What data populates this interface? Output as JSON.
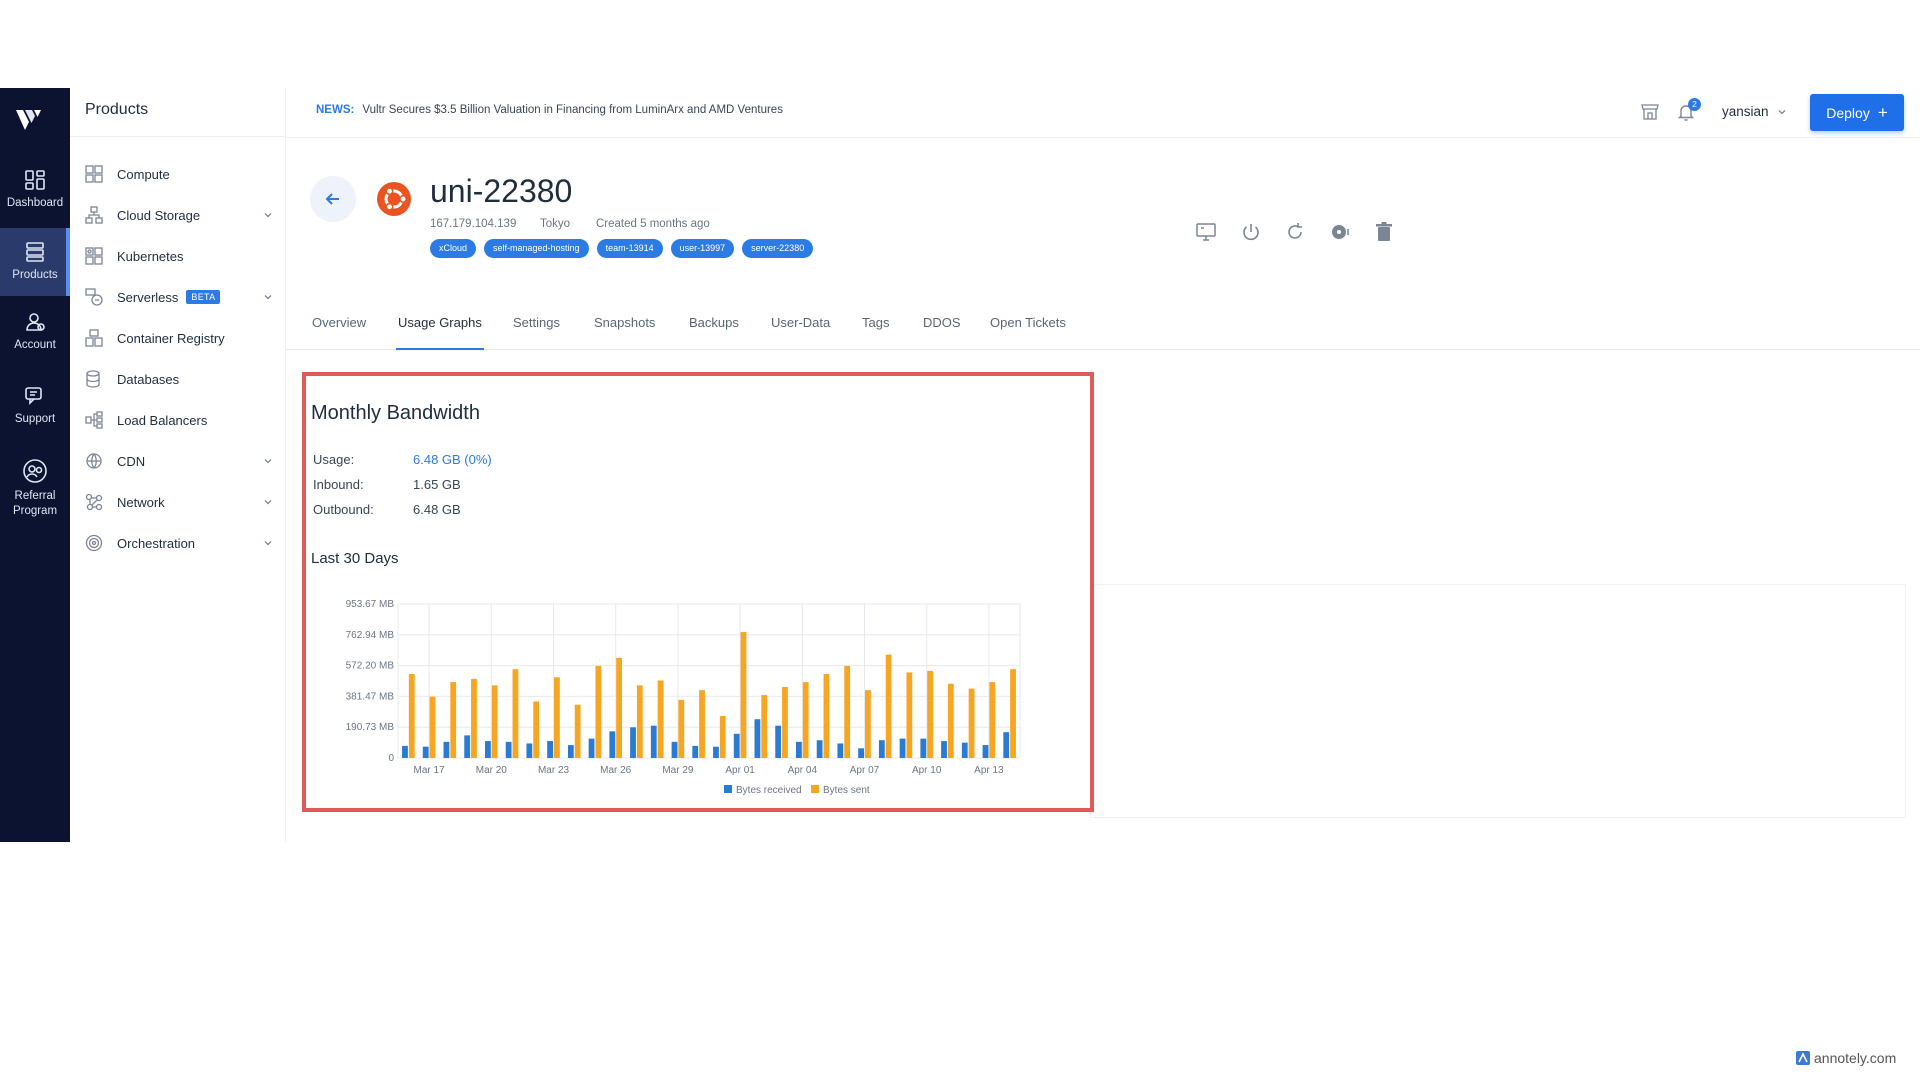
{
  "rail": {
    "items": [
      {
        "label": "Dashboard",
        "icon": "dashboard-icon"
      },
      {
        "label": "Products",
        "icon": "products-icon",
        "active": true
      },
      {
        "label": "Account",
        "icon": "account-icon"
      },
      {
        "label": "Support",
        "icon": "support-icon"
      },
      {
        "label": "Referral\nProgram",
        "icon": "referral-icon"
      }
    ]
  },
  "panel": {
    "title": "Products",
    "items": [
      {
        "label": "Compute",
        "icon": "compute-icon",
        "expandable": false
      },
      {
        "label": "Cloud Storage",
        "icon": "cloud-storage-icon",
        "expandable": true
      },
      {
        "label": "Kubernetes",
        "icon": "kubernetes-icon",
        "expandable": false
      },
      {
        "label": "Serverless",
        "icon": "serverless-icon",
        "expandable": true,
        "badge": "BETA"
      },
      {
        "label": "Container Registry",
        "icon": "container-registry-icon",
        "expandable": false
      },
      {
        "label": "Databases",
        "icon": "databases-icon",
        "expandable": false
      },
      {
        "label": "Load Balancers",
        "icon": "load-balancers-icon",
        "expandable": false
      },
      {
        "label": "CDN",
        "icon": "cdn-icon",
        "expandable": true
      },
      {
        "label": "Network",
        "icon": "network-icon",
        "expandable": true
      },
      {
        "label": "Orchestration",
        "icon": "orchestration-icon",
        "expandable": true
      }
    ]
  },
  "topbar": {
    "news_label": "NEWS:",
    "news_text": "Vultr Secures $3.5 Billion Valuation in Financing from LuminArx and AMD Ventures",
    "notification_count": "2",
    "username": "yansian",
    "deploy_label": "Deploy"
  },
  "server": {
    "name": "uni-22380",
    "ip": "167.179.104.139",
    "location": "Tokyo",
    "created": "Created 5 months ago",
    "tags": [
      "xCloud",
      "self-managed-hosting",
      "team-13914",
      "user-13997",
      "server-22380"
    ]
  },
  "tabs": [
    "Overview",
    "Usage Graphs",
    "Settings",
    "Snapshots",
    "Backups",
    "User-Data",
    "Tags",
    "DDOS",
    "Open Tickets"
  ],
  "active_tab": "Usage Graphs",
  "bandwidth": {
    "title": "Monthly Bandwidth",
    "usage_label": "Usage:",
    "usage_value": "6.48 GB (0%)",
    "inbound_label": "Inbound:",
    "inbound_value": "1.65 GB",
    "outbound_label": "Outbound:",
    "outbound_value": "6.48 GB",
    "period_title": "Last 30 Days"
  },
  "colors": {
    "accent": "#2c7be5",
    "received": "#2b7bd3",
    "sent": "#f6a623",
    "highlight": "#e05a5a",
    "rail": "#0b1330"
  },
  "chart_data": {
    "type": "bar",
    "title": "",
    "xlabel": "",
    "ylabel": "",
    "y_ticks": [
      "0",
      "190.73 MB",
      "381.47 MB",
      "572.20 MB",
      "762.94 MB",
      "953.67 MB"
    ],
    "ylim": [
      0,
      953.67
    ],
    "x_tick_labels": [
      "Mar 17",
      "Mar 20",
      "Mar 23",
      "Mar 26",
      "Mar 29",
      "Apr 01",
      "Apr 04",
      "Apr 07",
      "Apr 10",
      "Apr 13"
    ],
    "categories": [
      "Mar 16",
      "Mar 17",
      "Mar 18",
      "Mar 19",
      "Mar 20",
      "Mar 21",
      "Mar 22",
      "Mar 23",
      "Mar 24",
      "Mar 25",
      "Mar 26",
      "Mar 27",
      "Mar 28",
      "Mar 29",
      "Mar 30",
      "Mar 31",
      "Apr 01",
      "Apr 02",
      "Apr 03",
      "Apr 04",
      "Apr 05",
      "Apr 06",
      "Apr 07",
      "Apr 08",
      "Apr 09",
      "Apr 10",
      "Apr 11",
      "Apr 12",
      "Apr 13",
      "Apr 14"
    ],
    "series": [
      {
        "name": "Bytes received",
        "values": [
          75,
          70,
          100,
          140,
          105,
          100,
          90,
          105,
          80,
          120,
          165,
          190,
          200,
          100,
          75,
          70,
          150,
          240,
          200,
          100,
          110,
          90,
          60,
          110,
          120,
          120,
          105,
          95,
          80,
          160
        ]
      },
      {
        "name": "Bytes sent",
        "values": [
          520,
          380,
          470,
          490,
          450,
          550,
          350,
          500,
          330,
          570,
          620,
          450,
          480,
          360,
          420,
          260,
          780,
          390,
          440,
          470,
          520,
          570,
          420,
          640,
          530,
          540,
          460,
          430,
          470,
          550
        ]
      }
    ],
    "legend": "bottom-center",
    "grid": true
  }
}
